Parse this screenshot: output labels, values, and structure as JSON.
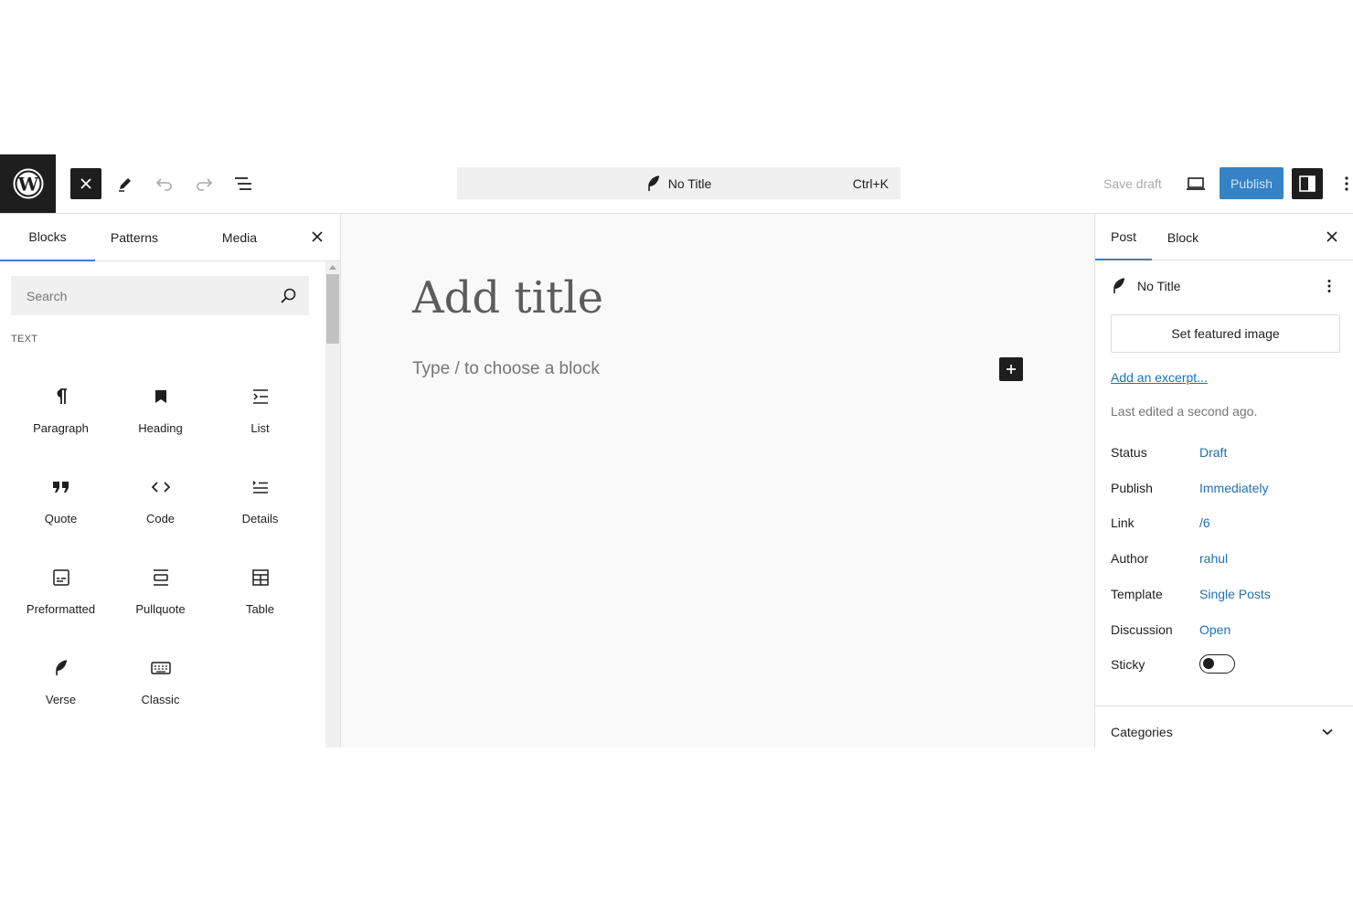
{
  "topbar": {
    "logo": "wordpress-logo",
    "command_title": "No Title",
    "command_shortcut": "Ctrl+K",
    "save_draft": "Save draft",
    "publish": "Publish",
    "accent_color": "#3582c4"
  },
  "inserter": {
    "tabs": [
      "Blocks",
      "Patterns",
      "Media"
    ],
    "active_tab": "Blocks",
    "search_placeholder": "Search",
    "category": "TEXT",
    "blocks": [
      {
        "label": "Paragraph",
        "icon": "paragraph-icon"
      },
      {
        "label": "Heading",
        "icon": "bookmark-icon"
      },
      {
        "label": "List",
        "icon": "list-icon"
      },
      {
        "label": "Quote",
        "icon": "quote-icon"
      },
      {
        "label": "Code",
        "icon": "code-icon"
      },
      {
        "label": "Details",
        "icon": "details-icon"
      },
      {
        "label": "Preformatted",
        "icon": "preformatted-icon"
      },
      {
        "label": "Pullquote",
        "icon": "pullquote-icon"
      },
      {
        "label": "Table",
        "icon": "table-icon"
      },
      {
        "label": "Verse",
        "icon": "feather-icon"
      },
      {
        "label": "Classic",
        "icon": "keyboard-icon"
      }
    ]
  },
  "canvas": {
    "title_placeholder": "Add title",
    "block_placeholder": "Type / to choose a block"
  },
  "sidebar": {
    "tabs": [
      "Post",
      "Block"
    ],
    "active_tab": "Post",
    "post_title": "No Title",
    "featured_image": "Set featured image",
    "excerpt_link": "Add an excerpt...",
    "last_edited": "Last edited a second ago.",
    "meta": [
      {
        "label": "Status",
        "value": "Draft"
      },
      {
        "label": "Publish",
        "value": "Immediately"
      },
      {
        "label": "Link",
        "value": "/6"
      },
      {
        "label": "Author",
        "value": "rahul"
      },
      {
        "label": "Template",
        "value": "Single Posts"
      },
      {
        "label": "Discussion",
        "value": "Open"
      }
    ],
    "sticky_label": "Sticky",
    "sticky_on": false,
    "categories_label": "Categories",
    "link_color": "#2271b1"
  }
}
